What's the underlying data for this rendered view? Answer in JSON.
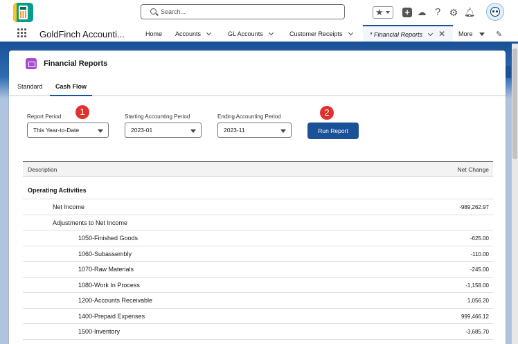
{
  "header": {
    "search_placeholder": "Search..."
  },
  "nav": {
    "app_name": "GoldFinch Accounti...",
    "items": [
      {
        "label": "Home"
      },
      {
        "label": "Accounts"
      },
      {
        "label": "GL Accounts"
      },
      {
        "label": "Customer Receipts"
      },
      {
        "label": "* Financial Reports"
      },
      {
        "label": "More"
      }
    ]
  },
  "card": {
    "title": "Financial Reports",
    "tabs": [
      {
        "label": "Standard"
      },
      {
        "label": "Cash Flow"
      }
    ],
    "active_tab": "Cash Flow"
  },
  "filters": {
    "report_period_label": "Report Period",
    "report_period_value": "This Year-to-Date",
    "start_period_label": "Starting Accounting Period",
    "start_period_value": "2023-01",
    "end_period_label": "Ending Accounting Period",
    "end_period_value": "2023-11",
    "run_button": "Run Report"
  },
  "annotations": {
    "badge1": "1",
    "badge2": "2"
  },
  "table": {
    "col_description": "Description",
    "col_net_change": "Net Change",
    "section": "Operating Activities",
    "rows": [
      {
        "label": "Net Income",
        "value": "-989,262.97"
      },
      {
        "label": "Adjustments to Net Income",
        "value": ""
      },
      {
        "label": "1050-Finished Goods",
        "value": "-625.00"
      },
      {
        "label": "1060-Subassembly",
        "value": "-110.00"
      },
      {
        "label": "1070-Raw Materials",
        "value": "-245.00"
      },
      {
        "label": "1080-Work In Process",
        "value": "-1,158.00"
      },
      {
        "label": "1200-Accounts Receivable",
        "value": "1,056.20"
      },
      {
        "label": "1400-Prepaid Expenses",
        "value": "999,466.12"
      },
      {
        "label": "1500-Inventory",
        "value": "-3,685.70"
      }
    ]
  },
  "colors": {
    "brand": "#1b5297",
    "badge": "#e0312e",
    "card_icon": "#a84cd3"
  }
}
